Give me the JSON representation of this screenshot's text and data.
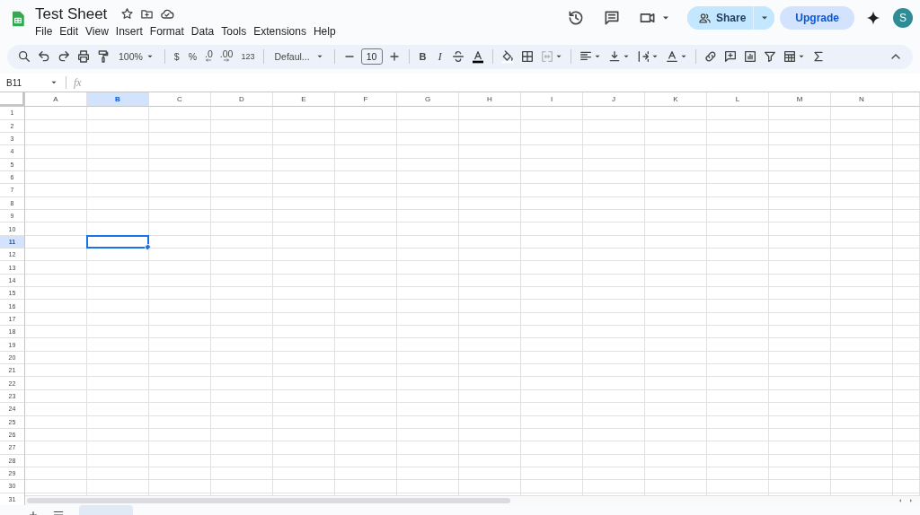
{
  "document": {
    "title": "Test Sheet"
  },
  "menu": [
    "File",
    "Edit",
    "View",
    "Insert",
    "Format",
    "Data",
    "Tools",
    "Extensions",
    "Help"
  ],
  "share_button": {
    "label": "Share"
  },
  "upgrade_button": {
    "label": "Upgrade"
  },
  "avatar": {
    "initial": "S"
  },
  "toolbar": {
    "zoom": "100%",
    "currency": "$",
    "percent": "%",
    "decrease_decimal": ".0",
    "increase_decimal": ".00",
    "number_format": "123",
    "font": "Defaul...",
    "font_size": "10",
    "bold": "B",
    "italic": "I"
  },
  "formula_bar": {
    "name_box": "B11",
    "fx": "fx"
  },
  "grid": {
    "columns": [
      {
        "label": "A",
        "selected": false
      },
      {
        "label": "B",
        "selected": true
      },
      {
        "label": "C",
        "selected": false
      },
      {
        "label": "D",
        "selected": false
      },
      {
        "label": "E",
        "selected": false
      },
      {
        "label": "F",
        "selected": false
      },
      {
        "label": "G",
        "selected": false
      },
      {
        "label": "H",
        "selected": false
      },
      {
        "label": "I",
        "selected": false
      },
      {
        "label": "J",
        "selected": false
      },
      {
        "label": "K",
        "selected": false
      },
      {
        "label": "L",
        "selected": false
      },
      {
        "label": "M",
        "selected": false
      },
      {
        "label": "N",
        "selected": false
      }
    ],
    "rows": [
      {
        "label": "1",
        "selected": false
      },
      {
        "label": "2",
        "selected": false
      },
      {
        "label": "3",
        "selected": false
      },
      {
        "label": "4",
        "selected": false
      },
      {
        "label": "5",
        "selected": false
      },
      {
        "label": "6",
        "selected": false
      },
      {
        "label": "7",
        "selected": false
      },
      {
        "label": "8",
        "selected": false
      },
      {
        "label": "9",
        "selected": false
      },
      {
        "label": "10",
        "selected": false
      },
      {
        "label": "11",
        "selected": true
      },
      {
        "label": "12",
        "selected": false
      },
      {
        "label": "13",
        "selected": false
      },
      {
        "label": "14",
        "selected": false
      },
      {
        "label": "15",
        "selected": false
      },
      {
        "label": "16",
        "selected": false
      },
      {
        "label": "17",
        "selected": false
      },
      {
        "label": "18",
        "selected": false
      },
      {
        "label": "19",
        "selected": false
      },
      {
        "label": "20",
        "selected": false
      },
      {
        "label": "21",
        "selected": false
      },
      {
        "label": "22",
        "selected": false
      },
      {
        "label": "23",
        "selected": false
      },
      {
        "label": "24",
        "selected": false
      },
      {
        "label": "25",
        "selected": false
      },
      {
        "label": "26",
        "selected": false
      },
      {
        "label": "27",
        "selected": false
      },
      {
        "label": "28",
        "selected": false
      },
      {
        "label": "29",
        "selected": false
      },
      {
        "label": "30",
        "selected": false
      },
      {
        "label": "31",
        "selected": false
      }
    ]
  }
}
